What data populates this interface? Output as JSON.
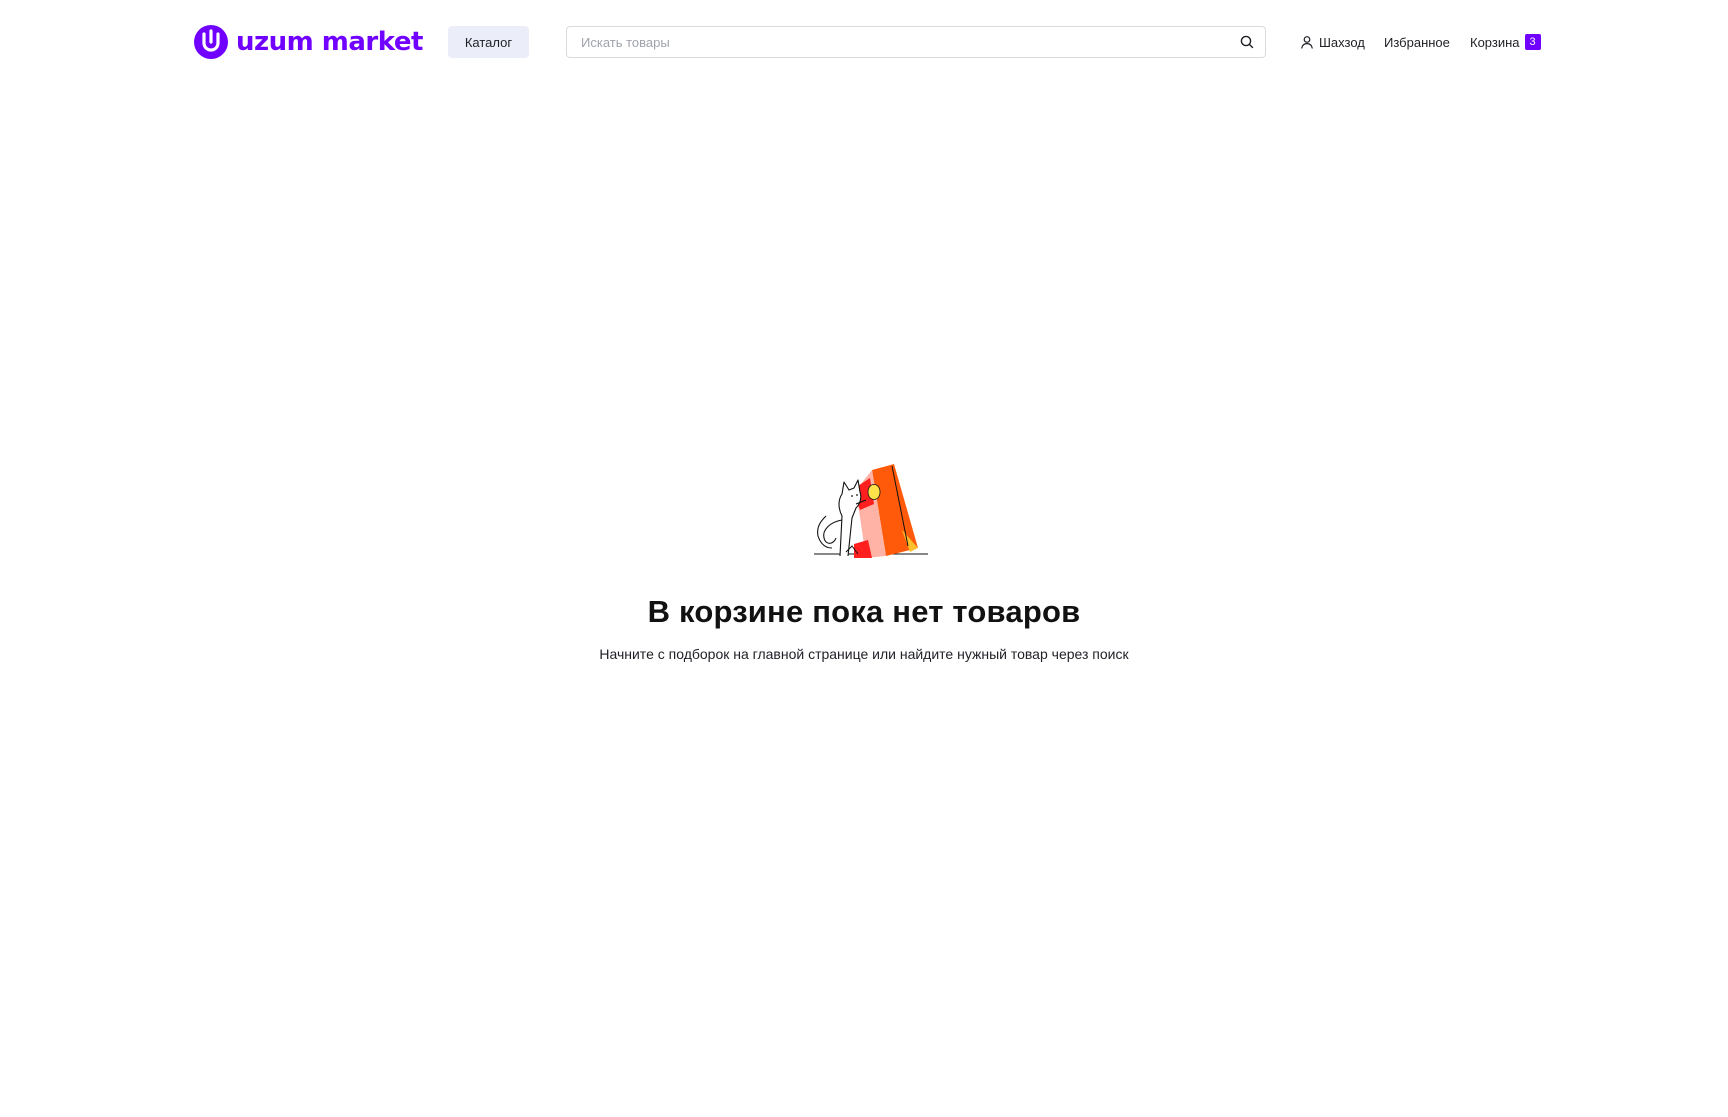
{
  "brand": {
    "name": "uzum market",
    "color": "#7000ff"
  },
  "header": {
    "catalog_label": "Каталог",
    "search": {
      "placeholder": "Искать товары",
      "value": ""
    },
    "user_label": "Шахзод",
    "favorites_label": "Избранное",
    "cart_label": "Корзина",
    "cart_count": "3"
  },
  "empty_cart": {
    "title": "В корзине пока нет товаров",
    "subtitle": "Начните с подборок на главной странице или найдите нужный товар через поиск"
  },
  "icons": {
    "search": "search-icon",
    "user": "user-icon",
    "illustration": "cat-with-shopping-bag-illustration"
  }
}
